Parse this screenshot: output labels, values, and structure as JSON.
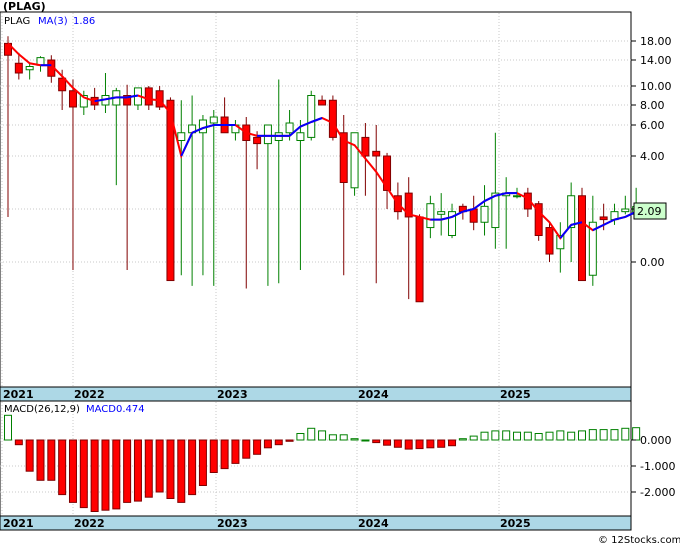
{
  "title": "(PLAG)",
  "watermark": "© 12Stocks.com",
  "colors": {
    "up": "#008000",
    "down": "#ff0000",
    "ma_up": "#0000ff",
    "ma_down": "#ff0000",
    "axis_band": "#add8e6",
    "grid": "#c8c8c8",
    "last_price_box": "#ccffcc"
  },
  "chart_data": [
    {
      "type": "candlestick",
      "legend": {
        "symbol": "PLAG",
        "indicator": "MA(3)",
        "value": "1.86"
      },
      "y_ticks": [
        "18.00",
        "14.00",
        "10.00",
        "8.00",
        "6.00",
        "4.00",
        "2.00",
        "0.00"
      ],
      "x_labels": [
        "2021",
        "2022",
        "2023",
        "2024",
        "2025"
      ],
      "last_price": "2.09",
      "grid": true,
      "candles": [
        {
          "o": 17.5,
          "h": 19.0,
          "l": 1.7,
          "c": 15.0
        },
        {
          "o": 13.5,
          "h": 15.5,
          "l": 11.0,
          "c": 12.0
        },
        {
          "o": 12.5,
          "h": 13.5,
          "l": 11.0,
          "c": 13.0
        },
        {
          "o": 13.2,
          "h": 14.8,
          "l": 12.2,
          "c": 14.5
        },
        {
          "o": 14.0,
          "h": 15.0,
          "l": 10.5,
          "c": 11.5
        },
        {
          "o": 11.2,
          "h": 12.5,
          "l": 7.5,
          "c": 9.5
        },
        {
          "o": 9.5,
          "h": 11.0,
          "l": -0.3,
          "c": 7.8
        },
        {
          "o": 7.8,
          "h": 9.5,
          "l": 7.0,
          "c": 9.0
        },
        {
          "o": 8.8,
          "h": 9.8,
          "l": 7.5,
          "c": 8.0
        },
        {
          "o": 8.0,
          "h": 12.0,
          "l": 7.2,
          "c": 9.0
        },
        {
          "o": 8.0,
          "h": 9.8,
          "l": 2.9,
          "c": 9.5
        },
        {
          "o": 9.0,
          "h": 10.2,
          "l": -0.3,
          "c": 8.0
        },
        {
          "o": 8.0,
          "h": 9.5,
          "l": 7.5,
          "c": 9.8
        },
        {
          "o": 9.8,
          "h": 10.0,
          "l": 7.5,
          "c": 8.0
        },
        {
          "o": 9.5,
          "h": 10.0,
          "l": 7.5,
          "c": 7.8
        },
        {
          "o": 8.5,
          "h": 8.8,
          "l": -0.7,
          "c": -0.7
        },
        {
          "o": 5.0,
          "h": 8.5,
          "l": -0.5,
          "c": 5.5
        },
        {
          "o": 5.5,
          "h": 9.0,
          "l": -0.9,
          "c": 6.0
        },
        {
          "o": 5.5,
          "h": 7.0,
          "l": -0.5,
          "c": 6.5
        },
        {
          "o": 6.2,
          "h": 7.5,
          "l": -0.9,
          "c": 6.8
        },
        {
          "o": 6.8,
          "h": 8.8,
          "l": 5.5,
          "c": 5.5
        },
        {
          "o": 5.5,
          "h": 6.5,
          "l": 5.0,
          "c": 6.0
        },
        {
          "o": 6.0,
          "h": 6.8,
          "l": -1.0,
          "c": 5.0
        },
        {
          "o": 5.2,
          "h": 5.6,
          "l": 3.5,
          "c": 4.8
        },
        {
          "o": 4.8,
          "h": 6.0,
          "l": -0.9,
          "c": 6.0
        },
        {
          "o": 5.0,
          "h": 11.0,
          "l": -0.8,
          "c": 5.5
        },
        {
          "o": 5.5,
          "h": 7.5,
          "l": 5.0,
          "c": 6.2
        },
        {
          "o": 5.0,
          "h": 6.5,
          "l": -0.3,
          "c": 5.5
        },
        {
          "o": 5.2,
          "h": 9.5,
          "l": 5.0,
          "c": 9.0
        },
        {
          "o": 8.5,
          "h": 9.0,
          "l": 8.0,
          "c": 8.0
        },
        {
          "o": 8.5,
          "h": 9.0,
          "l": 5.0,
          "c": 5.2
        },
        {
          "o": 5.5,
          "h": 7.0,
          "l": -0.5,
          "c": 3.0
        },
        {
          "o": 2.8,
          "h": 5.5,
          "l": 2.5,
          "c": 5.5
        },
        {
          "o": 5.2,
          "h": 6.2,
          "l": 2.5,
          "c": 4.0
        },
        {
          "o": 4.3,
          "h": 6.0,
          "l": -0.8,
          "c": 4.0
        },
        {
          "o": 4.0,
          "h": 4.2,
          "l": 2.0,
          "c": 2.7
        },
        {
          "o": 2.5,
          "h": 3.0,
          "l": 1.6,
          "c": 1.9
        },
        {
          "o": 2.6,
          "h": 3.2,
          "l": -1.4,
          "c": 1.7
        },
        {
          "o": 1.7,
          "h": 1.8,
          "l": -0.6,
          "c": -1.5
        },
        {
          "o": 1.3,
          "h": 2.5,
          "l": 0.9,
          "c": 2.2
        },
        {
          "o": 1.8,
          "h": 2.6,
          "l": 1.0,
          "c": 1.9
        },
        {
          "o": 1.0,
          "h": 2.2,
          "l": 0.9,
          "c": 1.9
        },
        {
          "o": 2.1,
          "h": 2.2,
          "l": 1.6,
          "c": 1.9
        },
        {
          "o": 2.0,
          "h": 2.5,
          "l": 1.2,
          "c": 1.5
        },
        {
          "o": 1.5,
          "h": 2.9,
          "l": 1.0,
          "c": 2.1
        },
        {
          "o": 1.3,
          "h": 5.5,
          "l": 0.5,
          "c": 2.6
        },
        {
          "o": 2.5,
          "h": 3.2,
          "l": 0.5,
          "c": 2.6
        },
        {
          "o": 2.5,
          "h": 2.8,
          "l": 2.4,
          "c": 2.5
        },
        {
          "o": 2.6,
          "h": 2.8,
          "l": 1.7,
          "c": 2.0
        },
        {
          "o": 2.2,
          "h": 2.3,
          "l": 0.8,
          "c": 1.0
        },
        {
          "o": 1.3,
          "h": 1.5,
          "l": 0.0,
          "c": 0.3
        },
        {
          "o": 0.5,
          "h": 1.5,
          "l": -0.4,
          "c": 1.0
        },
        {
          "o": 1.3,
          "h": 3.0,
          "l": 0.0,
          "c": 2.5
        },
        {
          "o": 2.5,
          "h": 2.8,
          "l": -0.7,
          "c": -0.7
        },
        {
          "o": -0.5,
          "h": 2.5,
          "l": -0.9,
          "c": 1.5
        },
        {
          "o": 1.7,
          "h": 2.2,
          "l": 1.2,
          "c": 1.6
        },
        {
          "o": 1.6,
          "h": 2.2,
          "l": 1.4,
          "c": 1.9
        },
        {
          "o": 1.9,
          "h": 2.5,
          "l": 1.8,
          "c": 2.0
        },
        {
          "o": 1.8,
          "h": 2.8,
          "l": 1.7,
          "c": 2.09
        }
      ],
      "ma": [
        {
          "i": 0,
          "v": 17.5
        },
        {
          "i": 1,
          "v": 15.2
        },
        {
          "i": 2,
          "v": 13.5
        },
        {
          "i": 3,
          "v": 13.2
        },
        {
          "i": 4,
          "v": 13.2
        },
        {
          "i": 5,
          "v": 11.5
        },
        {
          "i": 6,
          "v": 9.8
        },
        {
          "i": 7,
          "v": 8.8
        },
        {
          "i": 8,
          "v": 8.4
        },
        {
          "i": 9,
          "v": 8.6
        },
        {
          "i": 10,
          "v": 8.8
        },
        {
          "i": 11,
          "v": 8.8
        },
        {
          "i": 12,
          "v": 9.0
        },
        {
          "i": 13,
          "v": 8.6
        },
        {
          "i": 14,
          "v": 8.5
        },
        {
          "i": 15,
          "v": 7.2
        },
        {
          "i": 16,
          "v": 4.0
        },
        {
          "i": 17,
          "v": 5.5
        },
        {
          "i": 18,
          "v": 5.8
        },
        {
          "i": 19,
          "v": 6.0
        },
        {
          "i": 20,
          "v": 6.0
        },
        {
          "i": 21,
          "v": 6.0
        },
        {
          "i": 22,
          "v": 5.5
        },
        {
          "i": 23,
          "v": 5.3
        },
        {
          "i": 24,
          "v": 5.3
        },
        {
          "i": 25,
          "v": 5.3
        },
        {
          "i": 26,
          "v": 5.3
        },
        {
          "i": 27,
          "v": 5.9
        },
        {
          "i": 28,
          "v": 6.3
        },
        {
          "i": 29,
          "v": 6.7
        },
        {
          "i": 30,
          "v": 6.2
        },
        {
          "i": 31,
          "v": 5.0
        },
        {
          "i": 32,
          "v": 4.7
        },
        {
          "i": 33,
          "v": 3.9
        },
        {
          "i": 34,
          "v": 3.4
        },
        {
          "i": 35,
          "v": 2.8
        },
        {
          "i": 36,
          "v": 2.2
        },
        {
          "i": 37,
          "v": 1.8
        },
        {
          "i": 38,
          "v": 1.7
        },
        {
          "i": 39,
          "v": 1.6
        },
        {
          "i": 40,
          "v": 1.6
        },
        {
          "i": 41,
          "v": 1.7
        },
        {
          "i": 42,
          "v": 1.9
        },
        {
          "i": 43,
          "v": 2.0
        },
        {
          "i": 44,
          "v": 2.3
        },
        {
          "i": 45,
          "v": 2.5
        },
        {
          "i": 46,
          "v": 2.6
        },
        {
          "i": 47,
          "v": 2.6
        },
        {
          "i": 48,
          "v": 2.4
        },
        {
          "i": 49,
          "v": 1.9
        },
        {
          "i": 50,
          "v": 1.5
        },
        {
          "i": 51,
          "v": 0.9
        },
        {
          "i": 52,
          "v": 1.4
        },
        {
          "i": 53,
          "v": 1.5
        },
        {
          "i": 54,
          "v": 1.2
        },
        {
          "i": 55,
          "v": 1.4
        },
        {
          "i": 56,
          "v": 1.6
        },
        {
          "i": 57,
          "v": 1.7
        },
        {
          "i": 58,
          "v": 1.9
        }
      ]
    },
    {
      "type": "bar",
      "legend": {
        "label": "MACD(26,12,9)",
        "indicator": "MACD",
        "value": "0.474"
      },
      "y_ticks": [
        "0.000",
        "-1.000",
        "-2.000"
      ],
      "ylim": [
        -2.8,
        0.7
      ],
      "x_labels": [
        "2021",
        "2022",
        "2023",
        "2024",
        "2025"
      ],
      "values": [
        0.95,
        -0.18,
        -1.2,
        -1.55,
        -1.55,
        -2.1,
        -2.4,
        -2.6,
        -2.75,
        -2.7,
        -2.65,
        -2.4,
        -2.35,
        -2.2,
        -2.0,
        -2.25,
        -2.4,
        -2.1,
        -1.75,
        -1.25,
        -1.1,
        -0.9,
        -0.7,
        -0.55,
        -0.3,
        -0.18,
        -0.05,
        0.25,
        0.45,
        0.35,
        0.2,
        0.2,
        0.05,
        0.0,
        -0.1,
        -0.2,
        -0.28,
        -0.35,
        -0.33,
        -0.3,
        -0.28,
        -0.22,
        0.05,
        0.15,
        0.3,
        0.35,
        0.35,
        0.3,
        0.3,
        0.25,
        0.3,
        0.35,
        0.3,
        0.35,
        0.4,
        0.4,
        0.4,
        0.45,
        0.474
      ]
    }
  ]
}
